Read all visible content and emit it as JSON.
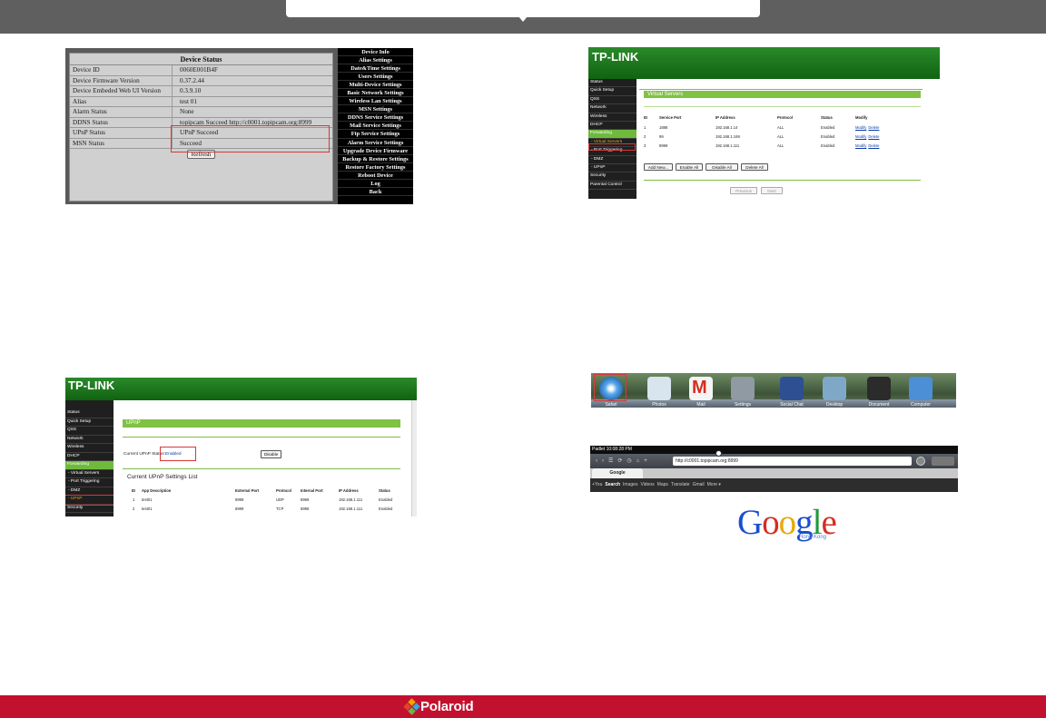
{
  "footer": {
    "brand": "Polaroid"
  },
  "device_status": {
    "title": "Device Status",
    "rows": [
      {
        "key": "Device ID",
        "value": "0060E001B4F"
      },
      {
        "key": "Device Firmware Version",
        "value": "0.37.2.44"
      },
      {
        "key": "Device Embeded Web UI Version",
        "value": "0.3.9.10"
      },
      {
        "key": "Alias",
        "value": "test 01"
      },
      {
        "key": "Alarm Status",
        "value": "None"
      },
      {
        "key": "DDNS Status",
        "value": "topipcam Succeed  http://c0001.topipcam.org:8999"
      },
      {
        "key": "UPnP Status",
        "value": "UPnP Succeed"
      },
      {
        "key": "MSN Status",
        "value": "Succeed"
      }
    ],
    "refresh_label": "Refresh",
    "menu": [
      "Device Info",
      "Alias Settings",
      "Date&Time Settings",
      "Users Settings",
      "Multi-Device Settings",
      "Basic Network Settings",
      "Wireless Lan Settings",
      "MSN Settings",
      "DDNS Service Settings",
      "Mail Service Settings",
      "Ftp Service Settings",
      "Alarm Service Settings",
      "Upgrade Device Firmware",
      "Backup & Restore Settings",
      "Restore Factory Settings",
      "Reboot Device",
      "Log",
      "Back"
    ]
  },
  "virtual_servers": {
    "logo": "TP-LINK",
    "sidebar": [
      "Status",
      "Quick Setup",
      "QSS",
      "Network",
      "Wireless",
      "DHCP",
      "Forwarding",
      "- Virtual Servers",
      "- Port Triggering",
      "- DMZ",
      "- UPnP",
      "Security",
      "Parental Control"
    ],
    "panel_title": "Virtual Servers",
    "columns": [
      "ID",
      "Service Port",
      "IP Address",
      "Protocol",
      "Status",
      "Modify"
    ],
    "rows": [
      {
        "id": "1",
        "port": "1888",
        "ip": "192.168.1.14",
        "protocol": "ALL",
        "status": "Enabled"
      },
      {
        "id": "2",
        "port": "99",
        "ip": "192.168.1.169",
        "protocol": "ALL",
        "status": "Enabled"
      },
      {
        "id": "3",
        "port": "8999",
        "ip": "192.168.1.111",
        "protocol": "ALL",
        "status": "Enabled"
      }
    ],
    "modify_label": "Modify",
    "delete_label": "Delete",
    "buttons": [
      "Add New...",
      "Enable All",
      "Disable All",
      "Delete All"
    ],
    "nav_buttons": [
      "Previous",
      "Next"
    ]
  },
  "upnp": {
    "logo": "TP-LINK",
    "sidebar": [
      "Status",
      "Quick Setup",
      "QSS",
      "Network",
      "Wireless",
      "DHCP",
      "Forwarding",
      "- Virtual Servers",
      "- Port Triggering",
      "- DMZ",
      "- UPnP",
      "Security"
    ],
    "panel_title": "UPnP",
    "status_label": "Current UPnP Status:",
    "status_value": "Enabled",
    "disable_label": "Disable",
    "list_title": "Current UPnP Settings List",
    "columns": [
      "ID",
      "App Description",
      "External Port",
      "Protocol",
      "Internal Port",
      "IP Address",
      "Status"
    ],
    "rows": [
      {
        "id": "1",
        "app": "test01",
        "ext": "8999",
        "proto": "UDP",
        "int": "8999",
        "ip": "192.168.1.111",
        "status": "Enabled"
      },
      {
        "id": "2",
        "app": "test01",
        "ext": "8999",
        "proto": "TCP",
        "int": "8999",
        "ip": "192.168.1.111",
        "status": "Enabled"
      }
    ]
  },
  "dock": {
    "items": [
      {
        "label": "Safari",
        "icon": "safari-icon",
        "color": "#3b8fd9"
      },
      {
        "label": "Photos",
        "icon": "photos-icon",
        "color": "#d8e4ee"
      },
      {
        "label": "Mail",
        "icon": "gmail-icon",
        "color": "#f4f4f4"
      },
      {
        "label": "Settings",
        "icon": "settings-icon",
        "color": "#8f9aa3"
      },
      {
        "label": "Social Chat",
        "icon": "social-chat-icon",
        "color": "#2f4f93"
      },
      {
        "label": "Desktop",
        "icon": "folder-icon",
        "color": "#7fa8c8"
      },
      {
        "label": "Document",
        "icon": "document-icon",
        "color": "#2b2b2b"
      },
      {
        "label": "Computer",
        "icon": "finder-icon",
        "color": "#4c8fd6"
      }
    ]
  },
  "browser": {
    "status_bar": "Padlet  10:08:28 PM",
    "url": "http://c0001.topipcam.org:8999",
    "tab": "Google",
    "gbar": [
      "+You",
      "Search",
      "Images",
      "Videos",
      "Maps",
      "Translate",
      "Gmail",
      "More ▾"
    ],
    "google_letters": [
      "G",
      "o",
      "o",
      "g",
      "l",
      "e"
    ],
    "google_colors": [
      "#1a4fcf",
      "#d62d20",
      "#e8a80c",
      "#1a4fcf",
      "#1f9a3a",
      "#d62d20"
    ],
    "google_region": "Hong Kong"
  }
}
